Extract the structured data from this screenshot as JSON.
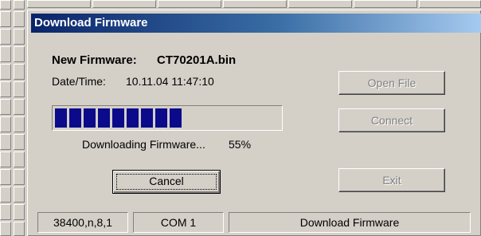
{
  "dialog": {
    "title": "Download Firmware",
    "firmware_label": "New Firmware:",
    "firmware_file": "CT70201A.bin",
    "datetime_label": "Date/Time:",
    "datetime_value": "10.11.04 11:47:10",
    "progress": {
      "percent": 55,
      "status_text": "Downloading Firmware...",
      "percent_text": "55%",
      "filled_blocks": 9,
      "bar_color": "#0a0a8a"
    },
    "buttons": {
      "cancel": "Cancel",
      "open_file": "Open File",
      "connect": "Connect",
      "exit": "Exit"
    },
    "status_bar": {
      "port_settings": "38400,n,8,1",
      "port": "COM 1",
      "mode": "Download Firmware"
    }
  },
  "colors": {
    "title_gradient_start": "#0a246a",
    "title_gradient_end": "#a6caf0",
    "face": "#d4d0c8",
    "disabled_text": "#808080"
  }
}
